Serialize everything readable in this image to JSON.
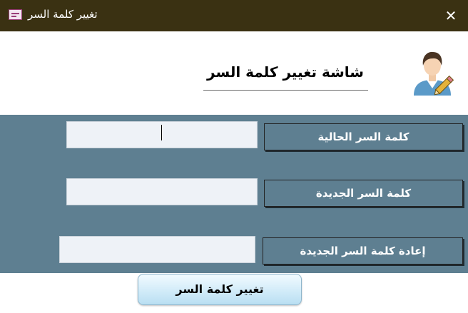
{
  "window": {
    "title": "تغيير كلمة السر",
    "close_glyph": "✕",
    "icon": "form-icon"
  },
  "header": {
    "page_title": "شاشة تغيير كلمة السر",
    "avatar_icon": "user-edit-icon"
  },
  "form": {
    "current_password_label": "كلمة السر الحالية",
    "current_password_value": "",
    "new_password_label": "كلمة السر الجديدة",
    "new_password_value": "",
    "confirm_password_label": "إعادة كلمة السر الجديدة",
    "confirm_password_value": ""
  },
  "actions": {
    "submit_label": "تغيير كلمة السر"
  },
  "colors": {
    "titlebar": "#3a3112",
    "panel": "#5e7f91",
    "input_bg": "#eef2f7",
    "button_top": "#f2fbff",
    "button_bottom": "#b9dff2"
  }
}
